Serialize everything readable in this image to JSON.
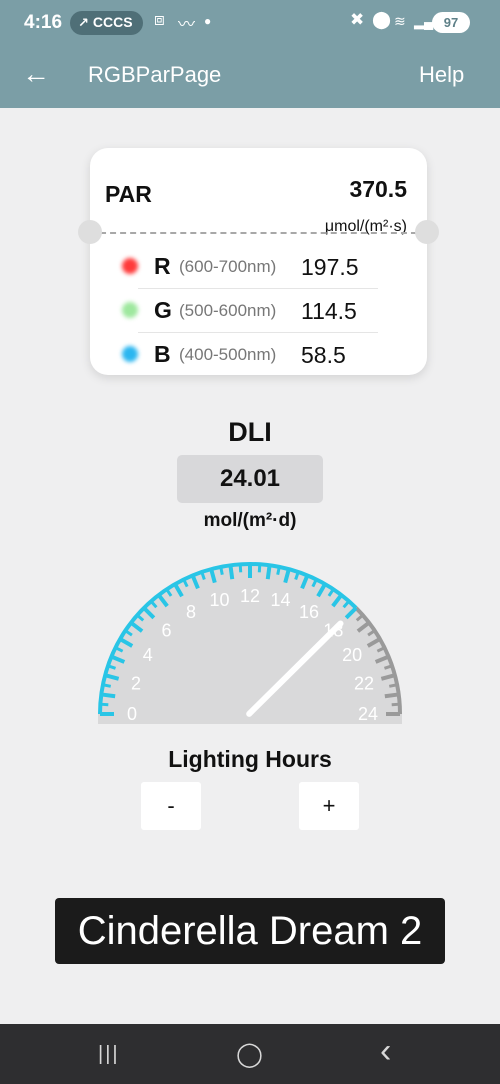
{
  "status_bar": {
    "time": "4:16",
    "pill_label": "CCCS",
    "battery": "97",
    "icons": [
      "screenshot-icon",
      "trend-icon",
      "dot-icon",
      "mute-icon",
      "location-icon",
      "wifi-icon",
      "signal-icon"
    ]
  },
  "app_bar": {
    "title": "RGBParPage",
    "help_label": "Help"
  },
  "par_card": {
    "label": "PAR",
    "value": "370.5",
    "unit": "μmol/(m²·s)",
    "rows": [
      {
        "letter": "R",
        "range": "(600-700nm)",
        "value": "197.5",
        "color": "#ff3b3b"
      },
      {
        "letter": "G",
        "range": "(500-600nm)",
        "value": "114.5",
        "color": "#9ee89e"
      },
      {
        "letter": "B",
        "range": "(400-500nm)",
        "value": "58.5",
        "color": "#2bb6f0"
      }
    ]
  },
  "dli": {
    "title": "DLI",
    "value": "24.01",
    "unit": "mol/(m²·d)"
  },
  "gauge": {
    "ticks": [
      "0",
      "2",
      "4",
      "6",
      "8",
      "10",
      "12",
      "14",
      "16",
      "18",
      "20",
      "22",
      "24"
    ],
    "min": 0,
    "max": 24,
    "value": 18,
    "active_color": "#29c5e6",
    "inactive_color": "#9a9a9a"
  },
  "lighting_hours": {
    "title": "Lighting Hours",
    "minus_label": "-",
    "plus_label": "+"
  },
  "banner": {
    "name": "Cinderella Dream 2"
  },
  "nav_bar": {
    "recents": "|||",
    "home": "◯",
    "back": "‹"
  }
}
